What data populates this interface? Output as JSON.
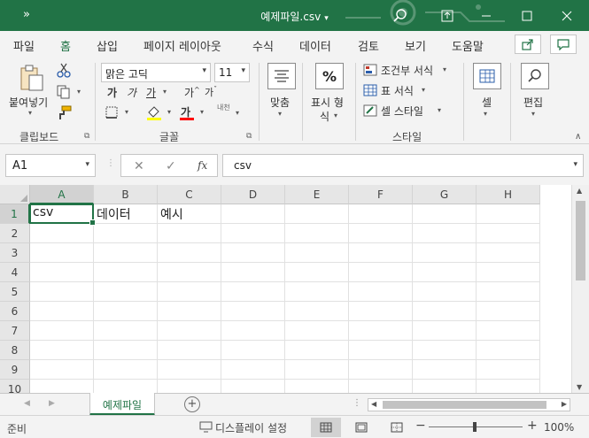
{
  "titlebar": {
    "qat_label": "»",
    "title": "예제파일.csv",
    "title_caret": "▾"
  },
  "tabs": [
    "파일",
    "홈",
    "삽입",
    "페이지 레이아웃",
    "수식",
    "데이터",
    "검토",
    "보기",
    "도움말"
  ],
  "active_tab": "홈",
  "ribbon": {
    "clipboard": {
      "paste_label": "붙여넣기",
      "group_label": "클립보드"
    },
    "font": {
      "name": "맑은 고딕",
      "size": "11",
      "bold_glyph": "가",
      "italic_glyph": "가",
      "underline_glyph": "가",
      "grow_glyph": "가",
      "shrink_glyph": "가",
      "color_glyph": "가",
      "phonetic_glyph": "내천",
      "group_label": "글꼴"
    },
    "alignment": {
      "label": "맞춤"
    },
    "number": {
      "symbol": "%",
      "label_line1": "표시 형",
      "label_line2": "식"
    },
    "styles": {
      "conditional": "조건부 서식",
      "table": "표 서식",
      "cell_style": "셀 스타일",
      "group_label": "스타일"
    },
    "cells": {
      "label": "셀"
    },
    "editing": {
      "label": "편집"
    }
  },
  "formula_bar": {
    "name_box": "A1",
    "cancel": "✕",
    "enter": "✓",
    "fx": "fx",
    "value": "csv"
  },
  "grid": {
    "columns": [
      "A",
      "B",
      "C",
      "D",
      "E",
      "F",
      "G",
      "H"
    ],
    "rows": [
      "1",
      "2",
      "3",
      "4",
      "5",
      "6",
      "7",
      "8",
      "9",
      "10"
    ],
    "selected_col": "A",
    "selected_row": "1",
    "row1": [
      "csv",
      "데이터",
      "예시",
      "",
      "",
      "",
      "",
      ""
    ]
  },
  "sheet_tabs": {
    "active": "예제파일",
    "add_label": "+"
  },
  "status_bar": {
    "ready": "준비",
    "display_settings": "디스플레이 설정",
    "zoom_minus": "−",
    "zoom_plus": "+",
    "zoom": "100%"
  }
}
